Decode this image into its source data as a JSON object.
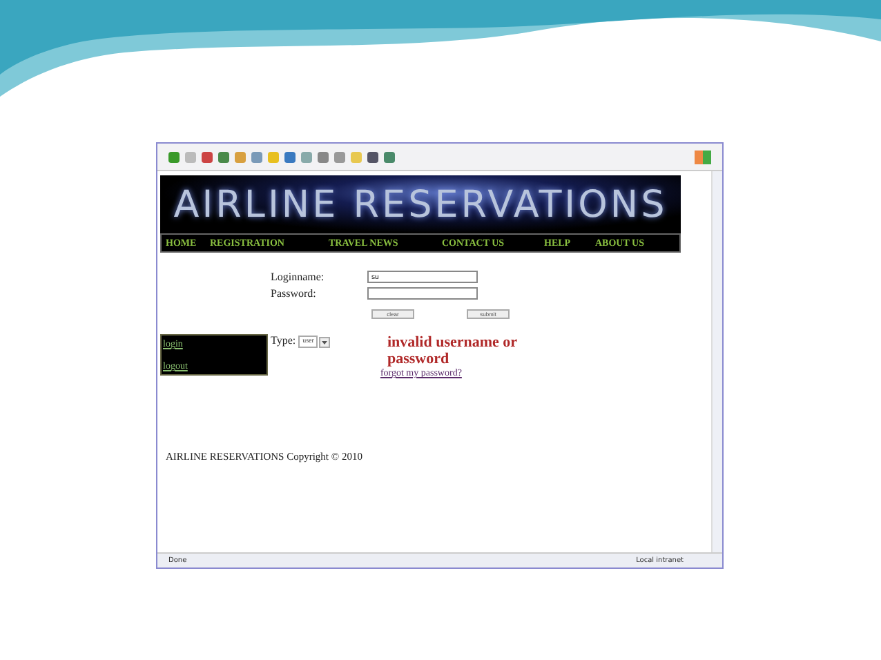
{
  "banner": {
    "title": "AIRLINE RESERVATIONS"
  },
  "nav": [
    "HOME",
    "REGISTRATION",
    "TRAVEL NEWS",
    "CONTACT US",
    "HELP",
    "ABOUT US"
  ],
  "form": {
    "fields": [
      {
        "label": "Loginname:",
        "value": "su"
      },
      {
        "label": "Password:"
      }
    ],
    "buttons": [
      "clear",
      "submit"
    ]
  },
  "side_menu": [
    "login",
    "logout"
  ],
  "type": {
    "label": "Type:",
    "value": "user"
  },
  "error": "invalid username or password",
  "forgot_link": "forgot my password?",
  "footer": "AIRLINE RESERVATIONS Copyright © 2010",
  "status_bar": {
    "left": "Done",
    "right": "Local intranet"
  }
}
